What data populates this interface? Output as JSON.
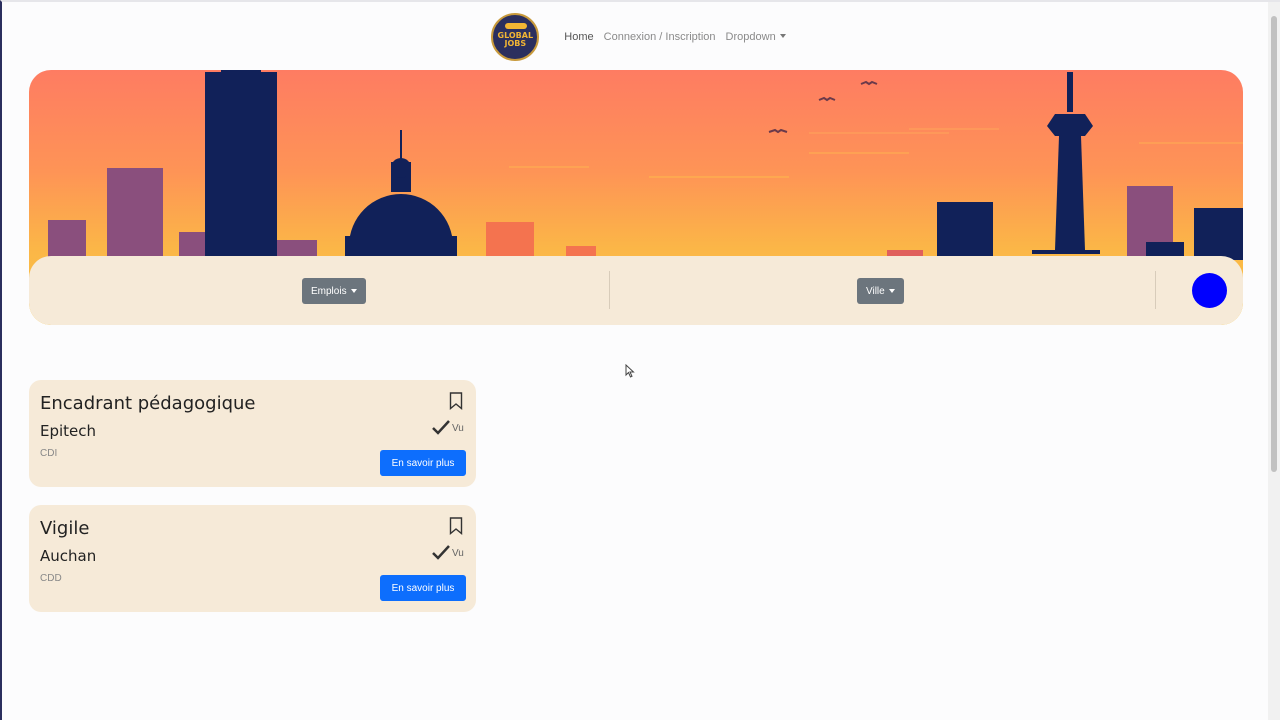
{
  "brand": {
    "logo_text": "GLOBAL JOBS"
  },
  "nav": {
    "items": [
      {
        "label": "Home",
        "active": true
      },
      {
        "label": "Connexion / Inscription",
        "active": false
      },
      {
        "label": "Dropdown",
        "active": false
      }
    ]
  },
  "search": {
    "jobs_label": "Emplois",
    "city_label": "Ville",
    "submit_color": "#0000ff"
  },
  "jobs": [
    {
      "title": "Encadrant pédagogique",
      "company": "Epitech",
      "contract": "CDI",
      "seen_label": "Vu",
      "more_label": "En savoir plus"
    },
    {
      "title": "Vigile",
      "company": "Auchan",
      "contract": "CDD",
      "seen_label": "Vu",
      "more_label": "En savoir plus"
    }
  ],
  "colors": {
    "card_bg": "#f6ead8",
    "primary": "#0d6efd",
    "secondary": "#6c757d",
    "skyline": "#112159"
  },
  "icons": [
    "bookmark-icon",
    "checkmark-icon",
    "caret-down-icon",
    "cursor-icon"
  ]
}
